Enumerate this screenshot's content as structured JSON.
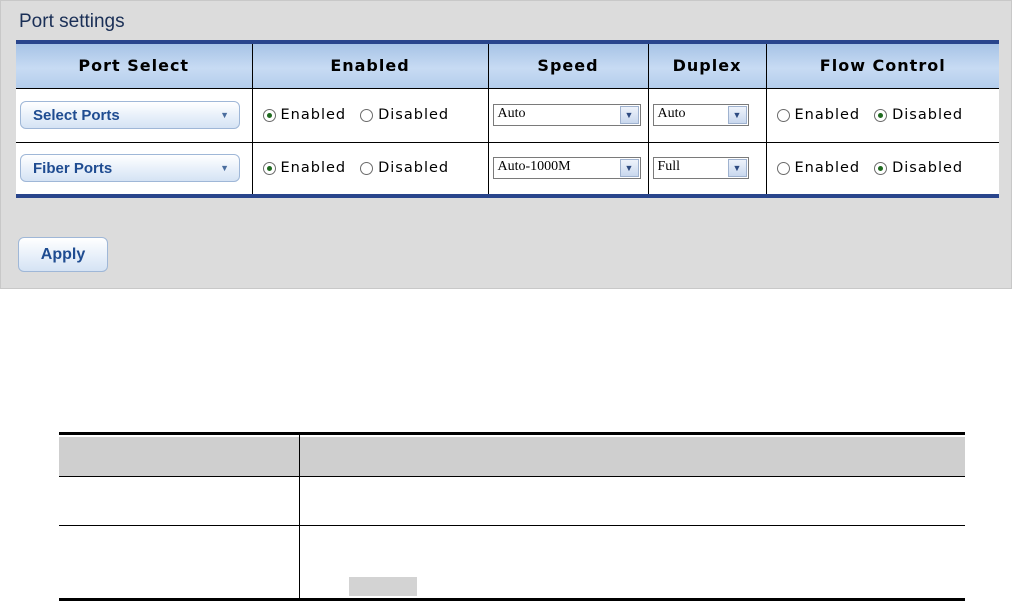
{
  "panel": {
    "title": "Port settings",
    "columns": [
      "Port Select",
      "Enabled",
      "Speed",
      "Duplex",
      "Flow Control"
    ],
    "rows": [
      {
        "port_select": "Select Ports",
        "enabled": {
          "on_label": "Enabled",
          "off_label": "Disabled",
          "selected": "Enabled"
        },
        "speed": "Auto",
        "duplex": "Auto",
        "flow_control": {
          "on_label": "Enabled",
          "off_label": "Disabled",
          "selected": "Disabled"
        }
      },
      {
        "port_select": "Fiber Ports",
        "enabled": {
          "on_label": "Enabled",
          "off_label": "Disabled",
          "selected": "Enabled"
        },
        "speed": "Auto-1000M",
        "duplex": "Full",
        "flow_control": {
          "on_label": "Enabled",
          "off_label": "Disabled",
          "selected": "Disabled"
        }
      }
    ],
    "apply_label": "Apply"
  },
  "icons": {
    "select_caret": "chevron-down-icon",
    "dropdown_arrow": "chevron-down-icon",
    "radio": "radio-button-icon"
  },
  "colors": {
    "panel_bg": "#dcdcdc",
    "title": "#1a2f56",
    "table_border": "#29458c",
    "header_bg": "#c7dbf3",
    "button_text": "#1f4c91",
    "doc_header_bg": "#cfcfcf"
  }
}
